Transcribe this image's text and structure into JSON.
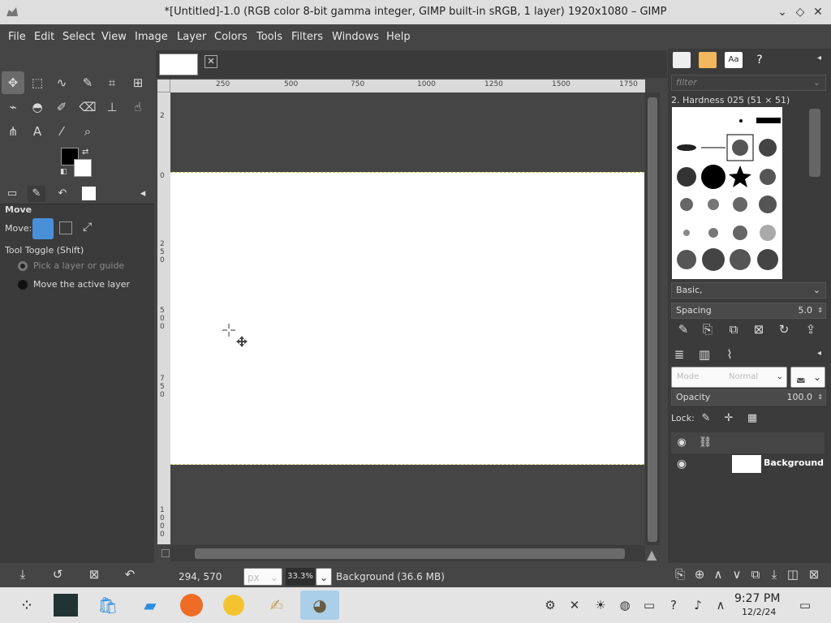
{
  "window": {
    "title": "*[Untitled]-1.0 (RGB color 8-bit gamma integer, GIMP built-in sRGB, 1 layer) 1920x1080 – GIMP"
  },
  "menu": [
    "File",
    "Edit",
    "Select",
    "View",
    "Image",
    "Layer",
    "Colors",
    "Tools",
    "Filters",
    "Windows",
    "Help"
  ],
  "tool_options": {
    "title": "Move",
    "move_label": "Move:",
    "toggle_label": "Tool Toggle  (Shift)",
    "option_pick": "Pick a layer or guide",
    "option_move": "Move the active layer"
  },
  "ruler": {
    "h_ticks": [
      "250",
      "500",
      "750",
      "1000",
      "1250",
      "1500",
      "1750"
    ],
    "v_ticks": [
      "2",
      "0",
      "2",
      "5",
      "0",
      "5",
      "0",
      "0",
      "7",
      "5",
      "0",
      "1",
      "0",
      "0",
      "0"
    ]
  },
  "status": {
    "coords": "294, 570",
    "unit": "px",
    "zoom": "33.3%",
    "layer_info": "Background (36.6 MB)"
  },
  "brushes": {
    "filter_placeholder": "filter",
    "current_brush": "2. Hardness 025 (51 × 51)",
    "preset": "Basic,",
    "spacing_label": "Spacing",
    "spacing_value": "5.0"
  },
  "layers": {
    "mode_label": "Mode",
    "mode_value": "Normal",
    "opacity_label": "Opacity",
    "opacity_value": "100.0",
    "lock_label": "Lock:",
    "items": [
      {
        "name": "Background"
      }
    ]
  },
  "taskbar": {
    "time": "9:27 PM",
    "date": "12/2/24"
  },
  "colors": {
    "fg": "#000000",
    "bg": "#ffffff",
    "accent": "#4a90d9",
    "active_app": "#a9cfe9"
  }
}
